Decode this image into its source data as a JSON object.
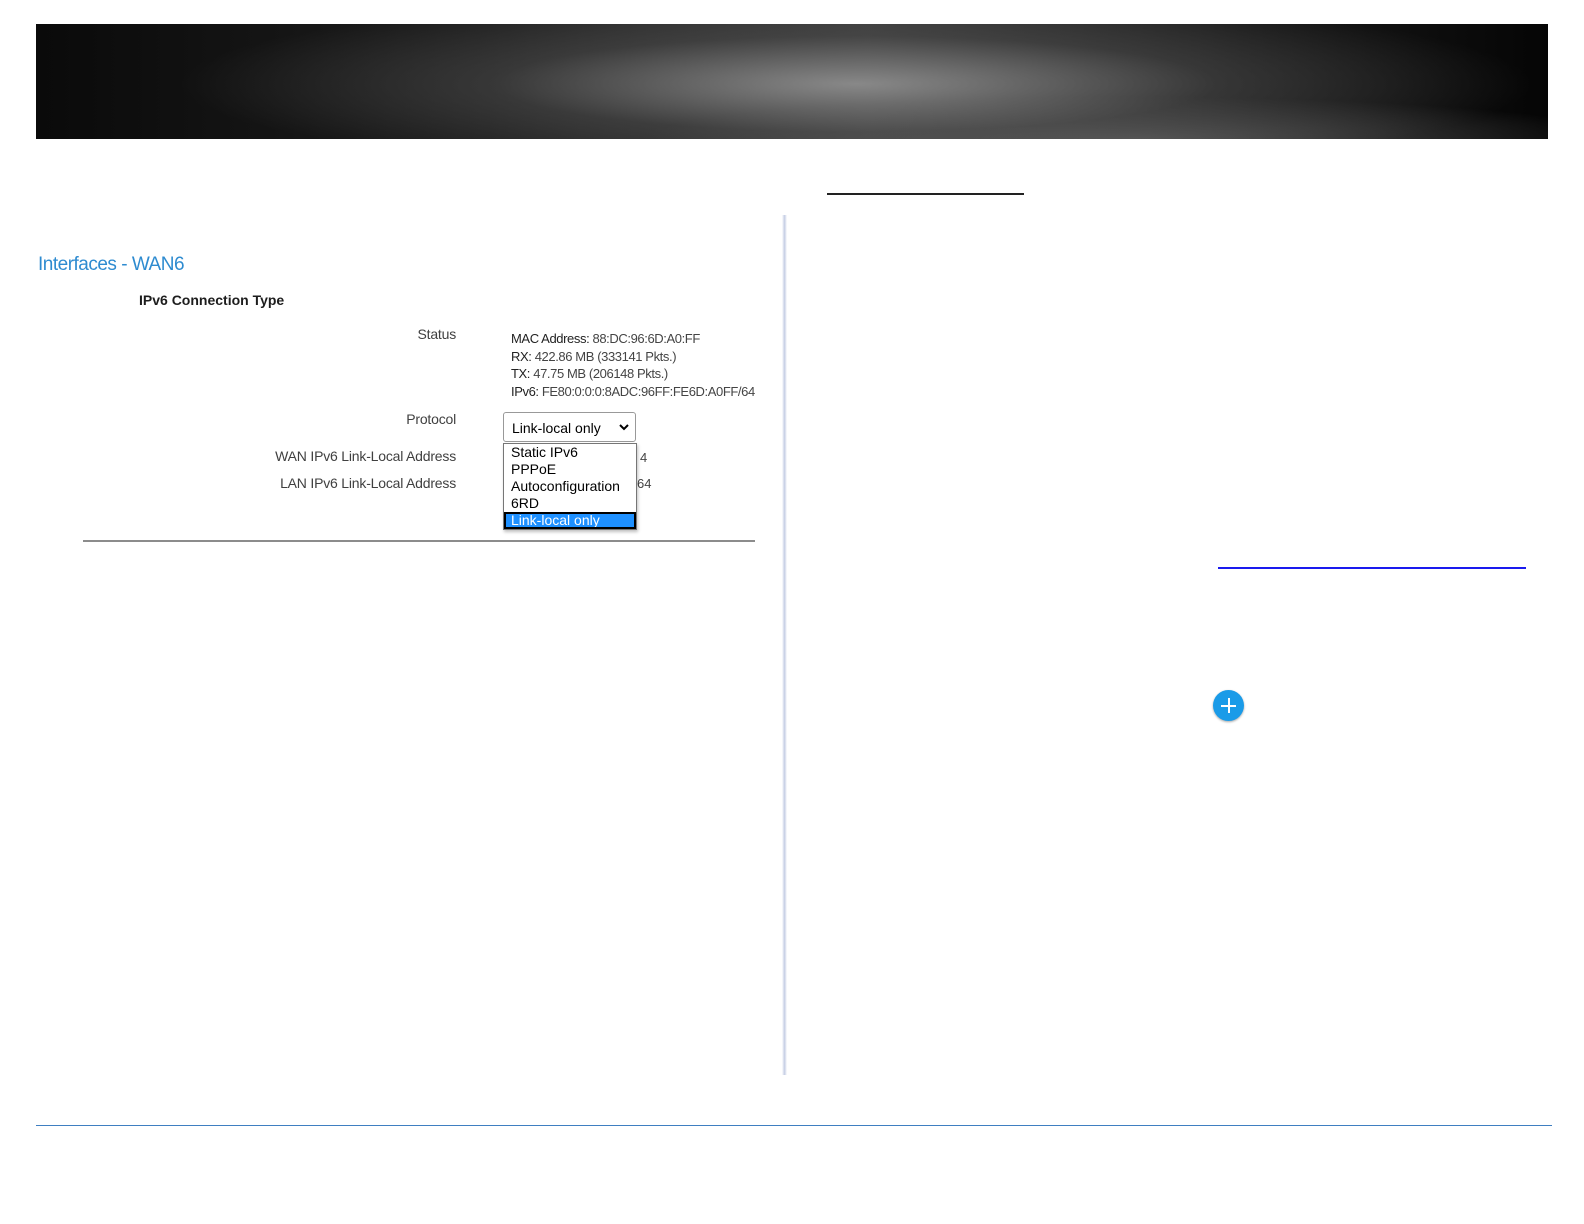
{
  "page": {
    "title": "Interfaces - WAN6",
    "section_heading": "IPv6 Connection Type"
  },
  "labels": {
    "status": "Status",
    "protocol": "Protocol",
    "wan_ll": "WAN IPv6 Link-Local Address",
    "lan_ll": "LAN IPv6 Link-Local Address"
  },
  "status": {
    "mac_label": "MAC Address:",
    "mac_value": "88:DC:96:6D:A0:FF",
    "rx_label": "RX:",
    "rx_value": "422.86 MB (333141 Pkts.)",
    "tx_label": "TX:",
    "tx_value": "47.75 MB (206148 Pkts.)",
    "ipv6_label": "IPv6:",
    "ipv6_value": "FE80:0:0:0:8ADC:96FF:FE6D:A0FF/64"
  },
  "protocol": {
    "selected": "Link-local only",
    "options": [
      "Static IPv6",
      "PPPoE",
      "Autoconfiguration",
      "6RD",
      "Link-local only"
    ]
  },
  "hidden_values": {
    "wan_tail": "4",
    "lan_tail": "64"
  },
  "colors": {
    "title_blue": "#2e8bd0",
    "selection_blue": "#1e90ff",
    "add_button": "#1a9be8",
    "footer_rule": "#3f7fc1"
  },
  "icons": {
    "add": "plus-circle-icon",
    "select_arrow": "chevron-down-icon"
  }
}
